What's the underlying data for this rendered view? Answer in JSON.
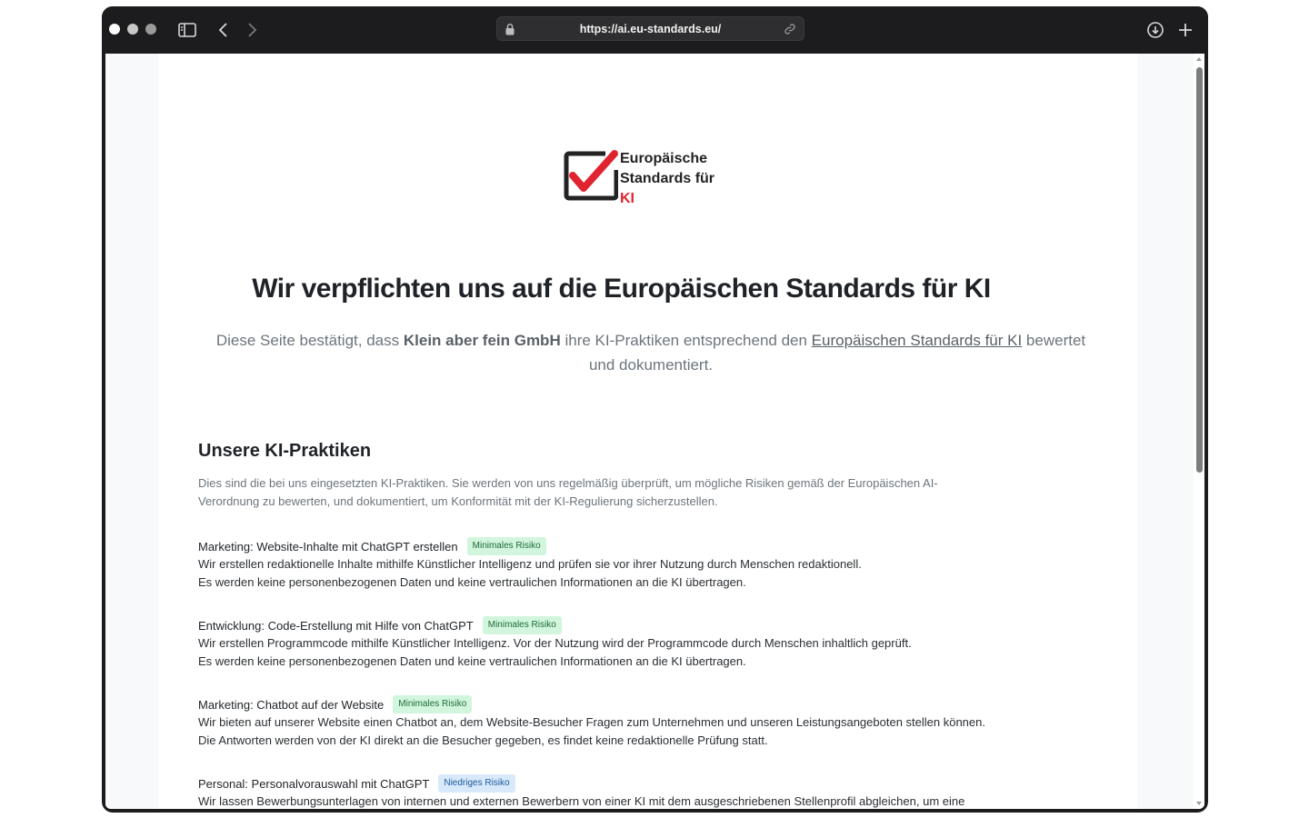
{
  "browser": {
    "url": "https://ai.eu-standards.eu/"
  },
  "logo": {
    "line1": "Europäische",
    "line2": "Standards für",
    "line3": "KI"
  },
  "hero": {
    "title": "Wir verpflichten uns auf die Europäischen Standards für KI",
    "sub_prefix": "Diese Seite bestätigt, dass ",
    "company": "Klein aber fein GmbH",
    "sub_middle": " ihre KI-Praktiken entsprechend den ",
    "link": "Europäischen Standards für KI",
    "sub_suffix": " bewertet und dokumentiert."
  },
  "section": {
    "title": "Unsere KI-Praktiken",
    "intro": "Dies sind die bei uns eingesetzten KI-Praktiken. Sie werden von uns regelmäßig überprüft, um mögliche Risiken gemäß der Europäischen AI-Verordnung zu bewerten, und dokumentiert, um Konformität mit der KI-Regulierung sicherzustellen."
  },
  "practices": [
    {
      "title": "Marketing: Website-Inhalte mit ChatGPT erstellen",
      "badge": "Minimales Risiko",
      "line1": "Wir erstellen redaktionelle Inhalte mithilfe Künstlicher Intelligenz und prüfen sie vor ihrer Nutzung durch Menschen redaktionell.",
      "line2": "Es werden keine personenbezogenen Daten und keine vertraulichen Informationen an die KI übertragen."
    },
    {
      "title": "Entwicklung: Code-Erstellung mit Hilfe von ChatGPT",
      "badge": "Minimales Risiko",
      "line1": "Wir erstellen Programmcode mithilfe Künstlicher Intelligenz. Vor der Nutzung wird der Programmcode durch Menschen inhaltlich geprüft.",
      "line2": "Es werden keine personenbezogenen Daten und keine vertraulichen Informationen an die KI übertragen."
    },
    {
      "title": "Marketing: Chatbot auf der Website",
      "badge": "Minimales Risiko",
      "line1": "Wir bieten auf unserer Website einen Chatbot an, dem Website-Besucher Fragen zum Unternehmen und unseren Leistungsangeboten stellen können.",
      "line2": "Die Antworten werden von der KI direkt an die Besucher gegeben, es findet keine redaktionelle Prüfung statt."
    },
    {
      "title": "Personal: Personalvorauswahl mit ChatGPT",
      "badge": "Niedriges Risiko",
      "line1": "Wir lassen Bewerbungsunterlagen von internen und externen Bewerbern von einer KI mit dem ausgeschriebenen Stellenprofil abgleichen, um eine",
      "line2": ""
    }
  ],
  "colors": {
    "badge_minimal_bg": "#d1f5dd",
    "badge_low_bg": "#d7e9fb",
    "logo_red": "#e0242f"
  }
}
